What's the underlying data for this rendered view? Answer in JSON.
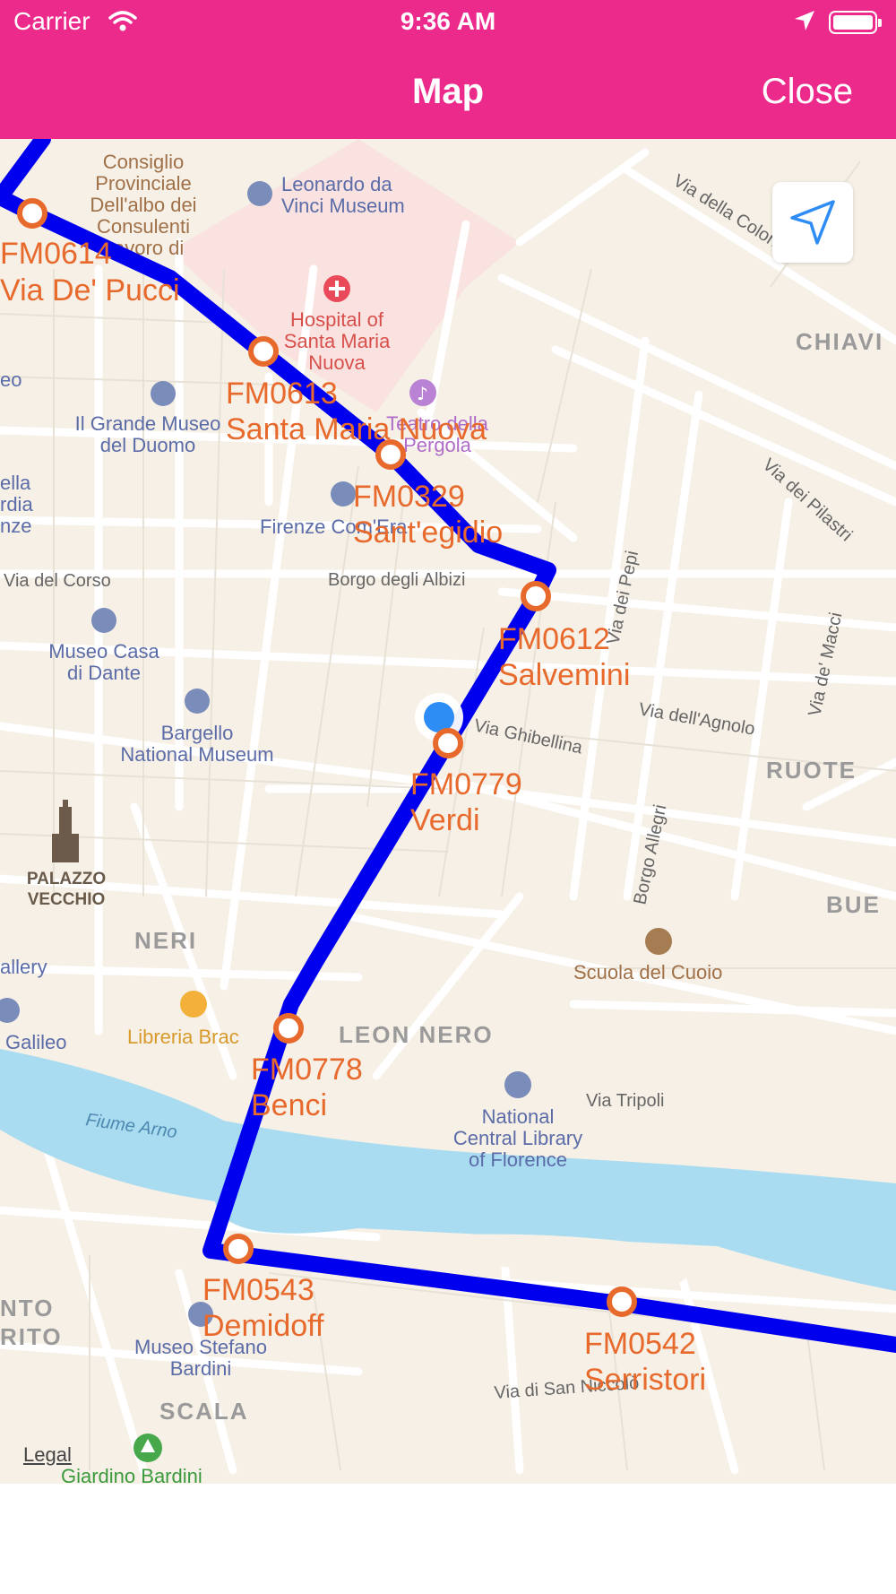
{
  "status_bar": {
    "carrier": "Carrier",
    "time": "9:36 AM"
  },
  "nav": {
    "title": "Map",
    "close_label": "Close"
  },
  "map": {
    "legal_label": "Legal",
    "areas": [
      "CHIAVI",
      "RUOTE",
      "BUE",
      "NERI",
      "LEON NERO",
      "SCALA",
      "NTO",
      "RITO"
    ],
    "streets": [
      "Via della Colonna",
      "Via dei Pilastri",
      "Via del Corso",
      "Borgo degli Albizi",
      "Via dei Pepi",
      "Via de' Macci",
      "Via dell'Agnolo",
      "Via Ghibellina",
      "Borgo Allegri",
      "Via Tripoli",
      "Via di San Niccolò",
      "Fiume Arno"
    ],
    "places": [
      "Consiglio Provinciale Dell'albo dei Consulenti Lavoro di",
      "Leonardo da Vinci Museum",
      "Hospital of Santa Maria Nuova",
      "Teatro della Pergola",
      "Il Grande Museo del Duomo",
      "Firenze Com'Era",
      "Museo Casa di Dante",
      "Bargello National Museum",
      "PALAZZO VECCHIO",
      "Libreria Brac",
      "Scuola del Cuoio",
      "National Central Library of Florence",
      "Museo Stefano Bardini",
      "Giardino Bardini",
      "eo",
      "ella rdia nze",
      "allery",
      "Galileo"
    ],
    "stops": [
      {
        "code": "FM0614",
        "name": "Via De' Pucci"
      },
      {
        "code": "FM0613",
        "name": "Santa Maria Nuova"
      },
      {
        "code": "FM0329",
        "name": "Sant'egidio"
      },
      {
        "code": "FM0612",
        "name": "Salvemini"
      },
      {
        "code": "FM0779",
        "name": "Verdi"
      },
      {
        "code": "FM0778",
        "name": "Benci"
      },
      {
        "code": "FM0543",
        "name": "Demidoff"
      },
      {
        "code": "FM0542",
        "name": "Serristori"
      }
    ]
  },
  "colors": {
    "nav_bar": "#ec2a8c",
    "route": "#0000ee",
    "stop": "#e8692c",
    "water": "#a9dcf0",
    "land": "#f6f0e6",
    "user_location": "#2e8df5"
  },
  "icons": [
    "wifi-icon",
    "location-arrow-icon",
    "battery-icon",
    "navigation-arrow-icon",
    "museum-icon",
    "hospital-icon",
    "music-icon",
    "book-icon",
    "school-icon",
    "tower-icon",
    "tree-icon"
  ]
}
